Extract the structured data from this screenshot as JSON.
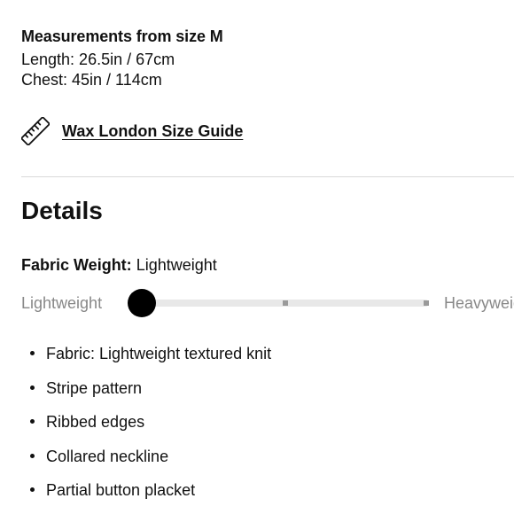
{
  "measurements": {
    "title": "Measurements from size M",
    "length": "Length: 26.5in / 67cm",
    "chest": "Chest: 45in / 114cm"
  },
  "size_guide": {
    "icon": "ruler-icon",
    "label": "Wax London Size Guide"
  },
  "details": {
    "heading": "Details",
    "fabric_weight": {
      "label": "Fabric Weight:",
      "value": "Lightweight",
      "slider": {
        "min_label": "Lightweight",
        "max_label": "Heavyweight",
        "steps": 3,
        "selected_step": 0
      }
    },
    "features": [
      "Fabric: Lightweight textured knit",
      "Stripe pattern",
      "Ribbed edges",
      "Collared neckline",
      "Partial button placket"
    ]
  }
}
